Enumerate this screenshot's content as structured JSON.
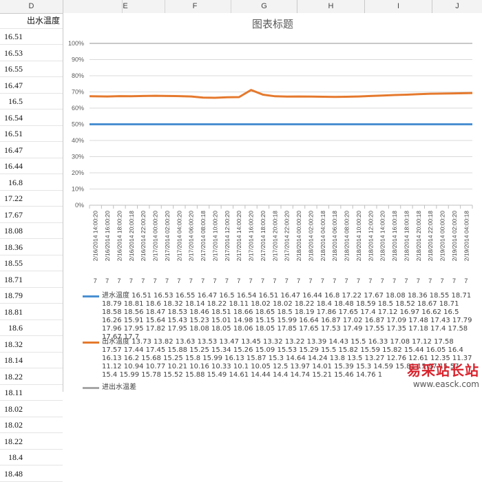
{
  "columns": [
    "D",
    "E",
    "F",
    "G",
    "H",
    "I",
    "J"
  ],
  "column_d": {
    "header": "出水温度",
    "values": [
      "16.51",
      "16.53",
      "16.55",
      "16.47",
      "16.5",
      "16.54",
      "16.51",
      "16.47",
      "16.44",
      "16.8",
      "17.22",
      "17.67",
      "18.08",
      "18.36",
      "18.55",
      "18.71",
      "18.79",
      "18.81",
      "18.6",
      "18.32",
      "18.14",
      "18.22",
      "18.11",
      "18.02",
      "18.02",
      "18.22",
      "18.4",
      "18.48"
    ]
  },
  "chart": {
    "title": "图表标题",
    "colors": {
      "series1": "#4a8fd1",
      "series2": "#e5792d",
      "refline": "#a6a6a6",
      "grid": "#d9d9d9"
    },
    "x_tick_labels": [
      "2/16/2014 14:00:20",
      "2/16/2014 16:00:20",
      "2/16/2014 18:00:20",
      "2/16/2014 20:00:18",
      "2/16/2014 22:00:20",
      "2/17/2014 00:00:20",
      "2/17/2014 02:00:20",
      "2/17/2014 04:00:20",
      "2/17/2014 06:00:20",
      "2/17/2014 08:00:18",
      "2/17/2014 10:00:20",
      "2/17/2014 12:00:20",
      "2/17/2014 14:00:20",
      "2/17/2014 16:00:20",
      "2/17/2014 18:00:20",
      "2/17/2014 20:00:18",
      "2/17/2014 22:00:20",
      "2/18/2014 00:00:20",
      "2/18/2014 02:00:20",
      "2/18/2014 04:00:18",
      "2/18/2014 06:00:18",
      "2/18/2014 08:00:20",
      "2/18/2014 10:00:20",
      "2/18/2014 12:00:20",
      "2/18/2014 14:00:20",
      "2/18/2014 16:00:18",
      "2/18/2014 18:00:18",
      "2/18/2014 20:00:18",
      "2/18/2014 22:00:18",
      "2/19/2014 00:00:20",
      "2/19/2014 02:00:20",
      "2/19/2014 04:00:18"
    ],
    "extra_row_label": "7",
    "legend": [
      {
        "name": "进水温度",
        "text": "进水温度 16.51 16.53 16.55 16.47 16.5 16.54 16.51 16.47 16.44 16.8 17.22 17.67 18.08 18.36 18.55 18.71 18.79 18.81 18.6 18.32 18.14 18.22 18.11 18.02 18.02 18.22 18.4 18.48 18.59 18.5 18.52 18.67 18.71 18.58 18.56 18.47 18.53 18.46 18.51 18.66 18.65 18.5 18.19 17.86 17.65 17.4 17.12 16.97 16.62 16.5 16.26 15.91 15.64 15.43 15.23 15.01 14.98 15.15 15.99 16.64 16.87 17.02 16.87 17.09 17.48 17.43 17.79 17.96 17.95 17.82 17.95 18.08 18.05 18.06 18.05 17.85 17.65 17.53 17.49 17.55 17.35 17.18 17.4 17.58 17.67 17.7"
      },
      {
        "name": "出水温度",
        "text": "出水温度 13.73 13.82 13.63 13.53 13.47 13.45 13.32 13.22 13.39 14.43 15.5 16.33 17.08 17.12 17.58 17.57 17.44 17.45 15.88 15.25 15.34 15.26 15.09 15.53 15.29 15.5 15.82 15.59 15.82 15.44 16.05 16.4 16.13 16.2 15.68 15.25 15.8 15.99 16.13 15.87 15.3 14.64 14.24 13.8 13.5 13.27 12.76 12.61 12.35 11.37 11.12 10.94 10.77 10.21 10.16 10.33 10.1 10.05 12.5 13.97 14.01 15.39 15.3 14.59 15.81 15.97 15.57 15.4 15.99 15.78 15.52 15.88 15.49 14.61 14.44 14.4 14.74 15.21 15.46 14.76 1"
      },
      {
        "name": "进出水温差",
        "text": "进出水温差"
      }
    ]
  },
  "chart_data": {
    "type": "line",
    "title": "图表标题",
    "ylim": [
      0,
      1
    ],
    "y_tick_labels": [
      "0%",
      "10%",
      "20%",
      "30%",
      "40%",
      "50%",
      "60%",
      "70%",
      "80%",
      "90%",
      "100%"
    ],
    "categories": [
      "2/16/2014 14:00:20",
      "2/16/2014 16:00:20",
      "2/16/2014 18:00:20",
      "2/16/2014 20:00:18",
      "2/16/2014 22:00:20",
      "2/17/2014 00:00:20",
      "2/17/2014 02:00:20",
      "2/17/2014 04:00:20",
      "2/17/2014 06:00:20",
      "2/17/2014 08:00:18",
      "2/17/2014 10:00:20",
      "2/17/2014 12:00:20",
      "2/17/2014 14:00:20",
      "2/17/2014 16:00:20",
      "2/17/2014 18:00:20",
      "2/17/2014 20:00:18",
      "2/17/2014 22:00:20",
      "2/18/2014 00:00:20",
      "2/18/2014 02:00:20",
      "2/18/2014 04:00:18",
      "2/18/2014 06:00:18",
      "2/18/2014 08:00:20",
      "2/18/2014 10:00:20",
      "2/18/2014 12:00:20",
      "2/18/2014 14:00:20",
      "2/18/2014 16:00:18",
      "2/18/2014 18:00:18",
      "2/18/2014 20:00:18",
      "2/18/2014 22:00:18",
      "2/19/2014 00:00:20",
      "2/19/2014 02:00:20",
      "2/19/2014 04:00:18"
    ],
    "series": [
      {
        "name": "进水温度",
        "values": [
          0.5,
          0.5,
          0.5,
          0.5,
          0.5,
          0.5,
          0.5,
          0.5,
          0.5,
          0.5,
          0.5,
          0.5,
          0.5,
          0.5,
          0.5,
          0.5,
          0.5,
          0.5,
          0.5,
          0.5,
          0.5,
          0.5,
          0.5,
          0.5,
          0.5,
          0.5,
          0.5,
          0.5,
          0.5,
          0.5,
          0.5,
          0.5
        ]
      },
      {
        "name": "出水温度",
        "values": [
          0.673,
          0.672,
          0.674,
          0.673,
          0.675,
          0.676,
          0.675,
          0.674,
          0.672,
          0.665,
          0.664,
          0.667,
          0.668,
          0.712,
          0.683,
          0.673,
          0.671,
          0.672,
          0.671,
          0.67,
          0.669,
          0.67,
          0.672,
          0.675,
          0.678,
          0.681,
          0.683,
          0.686,
          0.689,
          0.69,
          0.691,
          0.693
        ]
      },
      {
        "name": "",
        "values": [
          1,
          1,
          1,
          1,
          1,
          1,
          1,
          1,
          1,
          1,
          1,
          1,
          1,
          1,
          1,
          1,
          1,
          1,
          1,
          1,
          1,
          1,
          1,
          1,
          1,
          1,
          1,
          1,
          1,
          1,
          1,
          1
        ]
      }
    ],
    "grid": true,
    "legend_position": "bottom"
  },
  "watermark": {
    "title": "易采站长站",
    "url": "www.easck.com"
  }
}
